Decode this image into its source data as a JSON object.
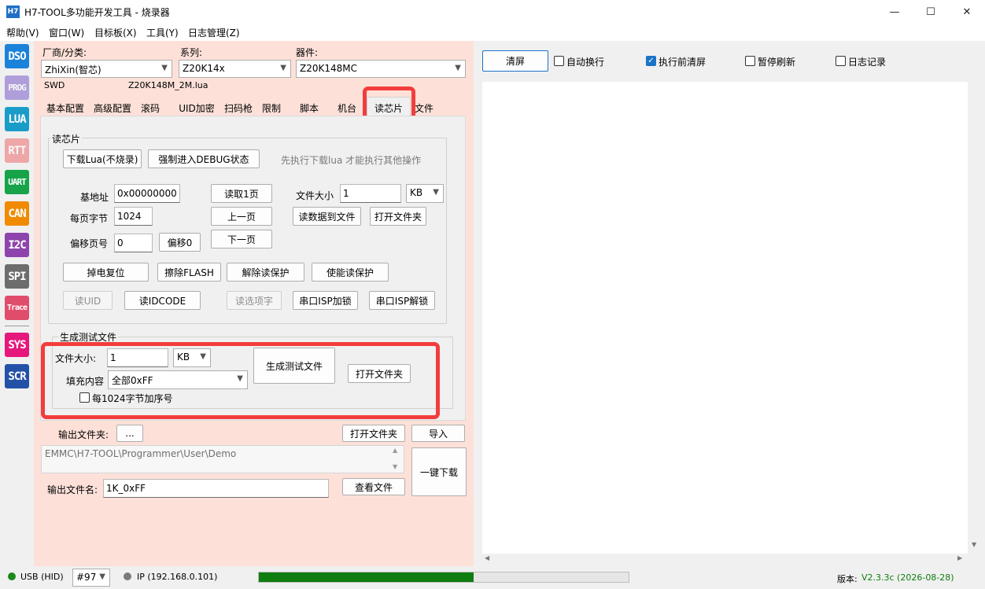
{
  "window": {
    "icon_text": "H7",
    "title": "H7-TOOL多功能开发工具 - 烧录器",
    "minimize": "—",
    "maximize": "☐",
    "close": "✕"
  },
  "menu": [
    "帮助(V)",
    "窗口(W)",
    "目标板(X)",
    "工具(Y)",
    "日志管理(Z)"
  ],
  "sidebar": [
    "DSO",
    "PROG",
    "LUA",
    "RTT",
    "UART",
    "CAN",
    "I2C",
    "SPI",
    "Trace",
    "SYS",
    "SCR"
  ],
  "device": {
    "vendor_label": "厂商/分类:",
    "vendor_value": "ZhiXin(智芯)",
    "series_label": "系列:",
    "series_value": "Z20K14x",
    "chip_label": "器件:",
    "chip_value": "Z20K148MC",
    "interface": "SWD",
    "lua_file": "Z20K148M_2M.lua"
  },
  "tabs": [
    "基本配置",
    "高级配置",
    "滚码",
    "UID加密",
    "扫码枪",
    "限制",
    "脚本",
    "机台",
    "读芯片",
    "文件"
  ],
  "readchip": {
    "group_title": "读芯片",
    "download_lua": "下载Lua(不烧录)",
    "force_debug": "强制进入DEBUG状态",
    "hint": "先执行下载lua 才能执行其他操作",
    "base_addr_label": "基地址",
    "base_addr_value": "0x00000000",
    "page_bytes_label": "每页字节",
    "page_bytes_value": "1024",
    "offset_page_label": "偏移页号",
    "offset_page_value": "0",
    "offset0": "偏移0",
    "read_page": "读取1页",
    "prev_page": "上一页",
    "next_page": "下一页",
    "file_size_label": "文件大小",
    "file_size_value": "1",
    "file_size_unit": "KB",
    "read_to_file": "读数据到文件",
    "open_folder": "打开文件夹",
    "power_reset": "掉电复位",
    "erase_flash": "擦除FLASH",
    "unlock_read": "解除读保护",
    "lock_read": "使能读保护",
    "read_uid": "读UID",
    "read_idcode": "读IDCODE",
    "read_option": "读选项字",
    "isp_lock": "串口ISP加锁",
    "isp_unlock": "串口ISP解锁"
  },
  "gen": {
    "group_title": "生成测试文件",
    "size_label": "文件大小:",
    "size_value": "1",
    "size_unit": "KB",
    "fill_label": "填充内容",
    "fill_value": "全部0xFF",
    "gen_button": "生成测试文件",
    "open_folder": "打开文件夹",
    "seq_check": "每1024字节加序号"
  },
  "output": {
    "folder_label": "输出文件夹:",
    "browse": "...",
    "open_folder": "打开文件夹",
    "import": "导入",
    "path": "EMMC\\H7-TOOL\\Programmer\\User\\Demo",
    "name_label": "输出文件名:",
    "name_value": "1K_0xFF",
    "view_file": "查看文件",
    "one_click": "一键下载"
  },
  "log": {
    "clear": "清屏",
    "auto_wrap": "自动换行",
    "clear_before": "执行前清屏",
    "pause_refresh": "暂停刷新",
    "log_record": "日志记录"
  },
  "status": {
    "usb": "USB (HID)",
    "port": "#97",
    "ip": "IP (192.168.0.101)",
    "progress": 0.58,
    "version_label": "版本:",
    "version_value": "V2.3.3c (2026-08-28)",
    "colors": {
      "usb_dot": "#1a8a1a",
      "ip_dot": "#7a7a7a",
      "progress": "#0f7d0f",
      "version": "#0e7d0e"
    }
  }
}
